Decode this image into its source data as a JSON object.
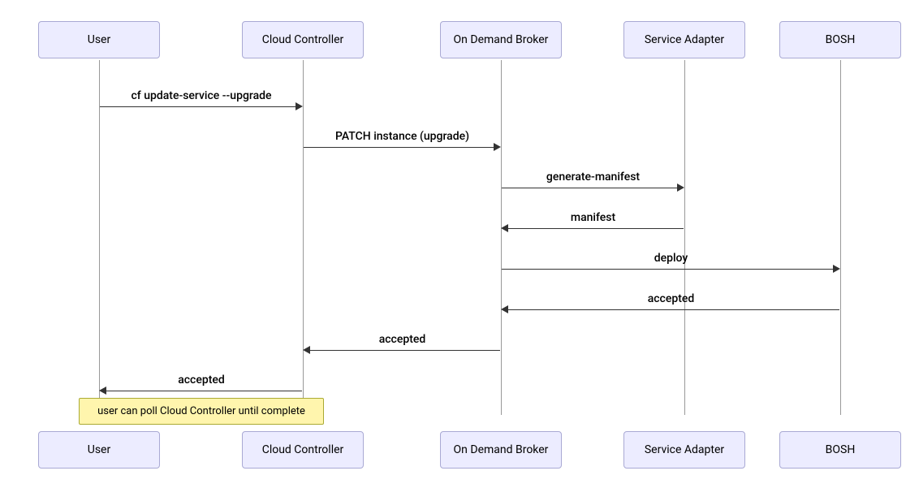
{
  "participants": {
    "user": "User",
    "cloud_controller": "Cloud Controller",
    "on_demand_broker": "On Demand Broker",
    "service_adapter": "Service Adapter",
    "bosh": "BOSH"
  },
  "messages": {
    "m1": "cf update-service --upgrade",
    "m2": "PATCH instance (upgrade)",
    "m3": "generate-manifest",
    "m4": "manifest",
    "m5": "deploy",
    "m6": "accepted",
    "m7": "accepted",
    "m8": "accepted"
  },
  "note": "user can poll Cloud Controller until complete",
  "chart_data": {
    "type": "sequence-diagram",
    "participants": [
      "User",
      "Cloud Controller",
      "On Demand Broker",
      "Service Adapter",
      "BOSH"
    ],
    "messages": [
      {
        "from": "User",
        "to": "Cloud Controller",
        "label": "cf update-service --upgrade"
      },
      {
        "from": "Cloud Controller",
        "to": "On Demand Broker",
        "label": "PATCH instance (upgrade)"
      },
      {
        "from": "On Demand Broker",
        "to": "Service Adapter",
        "label": "generate-manifest"
      },
      {
        "from": "Service Adapter",
        "to": "On Demand Broker",
        "label": "manifest"
      },
      {
        "from": "On Demand Broker",
        "to": "BOSH",
        "label": "deploy"
      },
      {
        "from": "BOSH",
        "to": "On Demand Broker",
        "label": "accepted"
      },
      {
        "from": "On Demand Broker",
        "to": "Cloud Controller",
        "label": "accepted"
      },
      {
        "from": "Cloud Controller",
        "to": "User",
        "label": "accepted"
      }
    ],
    "notes": [
      {
        "over": [
          "User",
          "Cloud Controller"
        ],
        "text": "user can poll Cloud Controller until complete"
      }
    ]
  }
}
